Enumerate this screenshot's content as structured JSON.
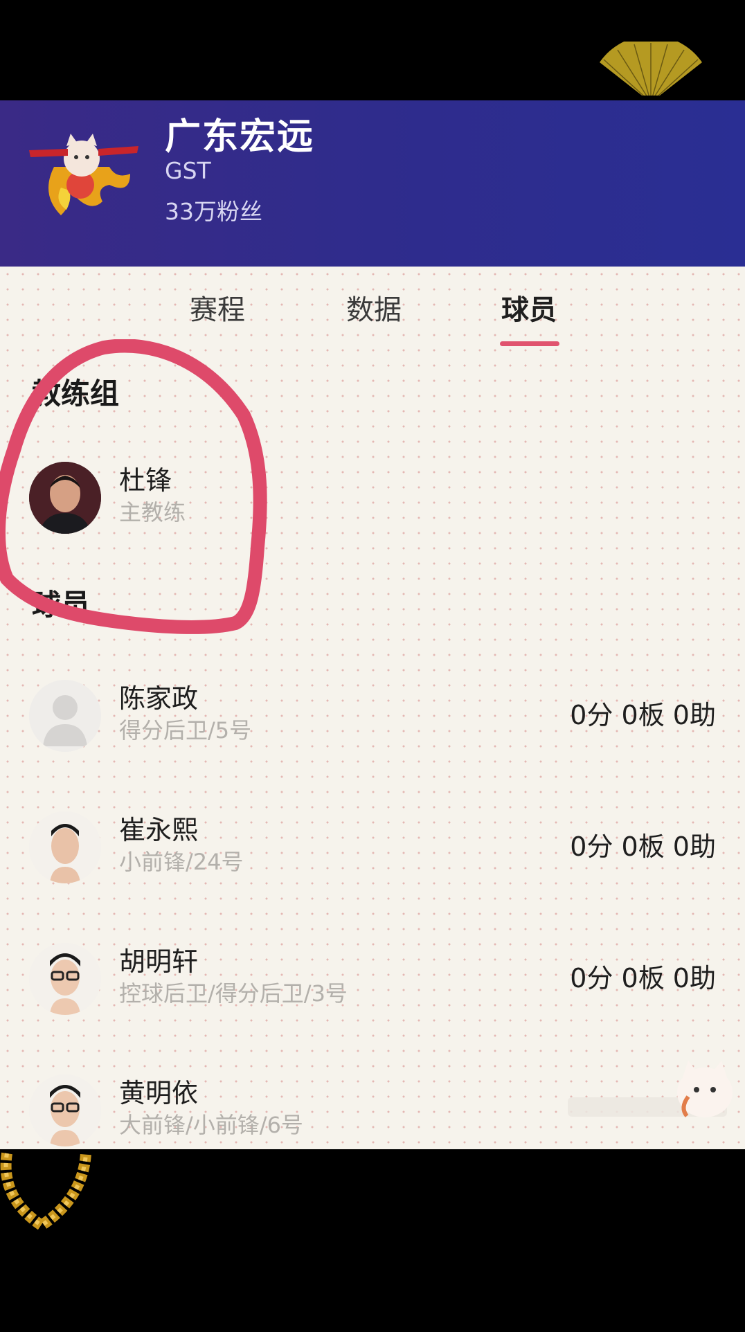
{
  "header": {
    "team_name": "广东宏远",
    "team_code": "GST",
    "fans": "33万粉丝"
  },
  "tabs": [
    {
      "label": "赛程",
      "active": false
    },
    {
      "label": "数据",
      "active": false
    },
    {
      "label": "球员",
      "active": true
    }
  ],
  "coach_section": {
    "title": "教练组",
    "coach": {
      "name": "杜锋",
      "role": "主教练"
    }
  },
  "players_section": {
    "title": "球员",
    "players": [
      {
        "name": "陈家政",
        "position": "得分后卫/5号",
        "stats": "0分 0板 0助"
      },
      {
        "name": "崔永熙",
        "position": "小前锋/24号",
        "stats": "0分 0板 0助"
      },
      {
        "name": "胡明轩",
        "position": "控球后卫/得分后卫/3号",
        "stats": "0分 0板 0助"
      },
      {
        "name": "黄明依",
        "position": "大前锋/小前锋/6号",
        "stats": ""
      }
    ]
  },
  "colors": {
    "header_bg": "#2f2c8c",
    "tab_accent": "#e0536e",
    "annotation_circle": "#de4a6a"
  }
}
